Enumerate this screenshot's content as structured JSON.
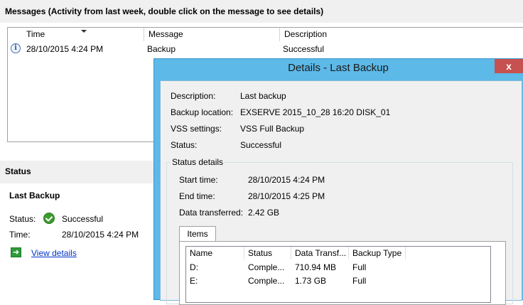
{
  "messages": {
    "title": "Messages (Activity from last week, double click on the message to see details)",
    "columns": [
      "Time",
      "Message",
      "Description"
    ],
    "rows": [
      {
        "icon": "info-icon",
        "time": "28/10/2015 4:24 PM",
        "message": "Backup",
        "description": "Successful"
      }
    ]
  },
  "status": {
    "section_title": "Status",
    "heading": "Last Backup",
    "status_label": "Status:",
    "status_value": "Successful",
    "time_label": "Time:",
    "time_value": "28/10/2015 4:24 PM",
    "view_details": "View details"
  },
  "dialog": {
    "title": "Details - Last Backup",
    "close": "x",
    "fields": [
      {
        "label": "Description:",
        "value": "Last backup"
      },
      {
        "label": "Backup location:",
        "value": "EXSERVE 2015_10_28 16:20 DISK_01"
      },
      {
        "label": "VSS settings:",
        "value": "VSS Full Backup"
      },
      {
        "label": "Status:",
        "value": "Successful"
      }
    ],
    "status_details": {
      "legend": "Status details",
      "fields": [
        {
          "label": "Start time:",
          "value": "28/10/2015 4:24 PM"
        },
        {
          "label": "End time:",
          "value": "28/10/2015 4:25 PM"
        },
        {
          "label": "Data transferred:",
          "value": "2.42 GB"
        }
      ]
    },
    "items_tab": "Items",
    "items_columns": [
      "Name",
      "Status",
      "Data Transf...",
      "Backup Type"
    ],
    "items": [
      {
        "name": "D:",
        "status": "Comple...",
        "data": "710.94 MB",
        "type": "Full"
      },
      {
        "name": "E:",
        "status": "Comple...",
        "data": "1.73 GB",
        "type": "Full"
      }
    ]
  },
  "colors": {
    "dialog_frame": "#5db9e8",
    "close_button": "#c75050",
    "link": "#0033cc",
    "success": "#3c9a2f"
  }
}
